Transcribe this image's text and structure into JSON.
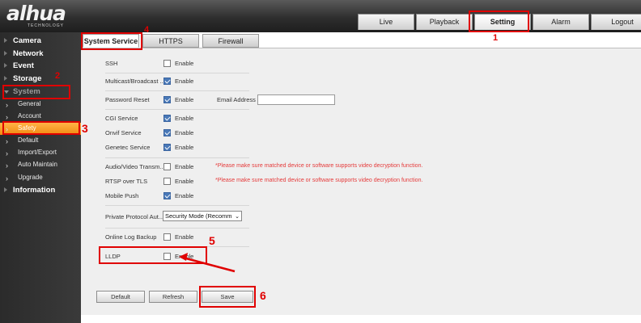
{
  "brand": {
    "name": "alhua",
    "tagline": "TECHNOLOGY"
  },
  "top_nav": [
    "Live",
    "Playback",
    "Setting",
    "Alarm",
    "Logout"
  ],
  "sidebar": {
    "main": [
      "Camera",
      "Network",
      "Event",
      "Storage",
      "System",
      "Information"
    ],
    "sub": [
      "General",
      "Account",
      "Safety",
      "Default",
      "Import/Export",
      "Auto Maintain",
      "Upgrade"
    ]
  },
  "subtabs": [
    "System Service",
    "HTTPS",
    "Firewall"
  ],
  "form": {
    "enable": "Enable",
    "ssh": "SSH",
    "multicast": "Multicast/Broadcast ...",
    "password_reset": "Password Reset",
    "email_label": "Email Address",
    "email_value": "",
    "cgi": "CGI Service",
    "onvif": "Onvif Service",
    "genetec": "Genetec Service",
    "av_transmission": "Audio/Video Transm...",
    "rtsp_tls": "RTSP over TLS",
    "warning": "*Please make sure matched device or software supports video decryption function.",
    "mobile_push": "Mobile Push",
    "private_protocol": "Private Protocol Aut...",
    "private_protocol_value": "Security Mode (Recomm",
    "online_log": "Online Log Backup",
    "lldp": "LLDP"
  },
  "buttons": {
    "default": "Default",
    "refresh": "Refresh",
    "save": "Save"
  },
  "annotations": [
    "1",
    "2",
    "3",
    "4",
    "5",
    "6"
  ],
  "colors": {
    "accent_orange": "#f28a10",
    "checkbox_blue": "#4a79b8",
    "warning_red": "#e53a3a",
    "annotation_red": "#e00000"
  }
}
